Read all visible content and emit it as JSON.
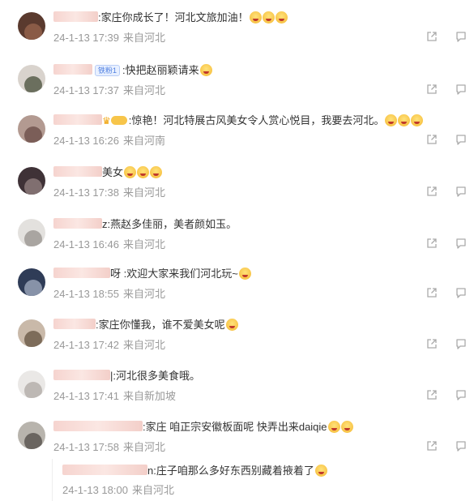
{
  "comments": [
    {
      "text": ":家庄你成长了！河北文旅加油！",
      "emojis": 3,
      "time": "24-1-13 17:39",
      "location": "来自河北",
      "avatar": [
        "#5a3a2e",
        "#8a5b46"
      ]
    },
    {
      "text": ":快把赵丽颖请来",
      "emojis": 1,
      "badge": "铁粉1",
      "time": "24-1-13 17:37",
      "location": "来自河北",
      "avatar": [
        "#d9d3cd",
        "#6b6f5e"
      ]
    },
    {
      "text": ":惊艳！河北特展古风美女令人赏心悦目，我要去河北。",
      "emojis": 3,
      "crown": true,
      "time": "24-1-13 16:26",
      "location": "来自河南",
      "avatar": [
        "#b39a91",
        "#7b5e58"
      ]
    },
    {
      "text": "美女",
      "emojis": 3,
      "time": "24-1-13 17:38",
      "location": "来自河北",
      "avatar": [
        "#3f3237",
        "#806f70"
      ]
    },
    {
      "text": "z:燕赵多佳丽，美者颜如玉。",
      "emojis": 0,
      "time": "24-1-13 16:46",
      "location": "来自河北",
      "avatar": [
        "#e3e1de",
        "#a9a5a1"
      ]
    },
    {
      "text": "呀 :欢迎大家来我们河北玩~",
      "emojis": 1,
      "time": "24-1-13 18:55",
      "location": "来自河北",
      "avatar": [
        "#2f3c57",
        "#8792a8"
      ]
    },
    {
      "text": ":家庄你懂我，谁不爱美女呢",
      "emojis": 1,
      "time": "24-1-13 17:42",
      "location": "来自河北",
      "avatar": [
        "#c9b9a9",
        "#7d6c5a"
      ]
    },
    {
      "text": "|:河北很多美食哦。",
      "emojis": 0,
      "time": "24-1-13 17:41",
      "location": "来自新加坡",
      "avatar": [
        "#eae8e6",
        "#bdb8b4"
      ]
    },
    {
      "text": ":家庄 咱正宗安徽板面呢 快弄出来daiqie",
      "emojis": 2,
      "time": "24-1-13 17:58",
      "location": "来自河北",
      "avatar": [
        "#b8b4ad",
        "#6a6560"
      ]
    }
  ],
  "subreply": {
    "text": "n:庄子咱那么多好东西别藏着掖着了",
    "emojis": 1,
    "time": "24-1-13 18:00",
    "location": "来自河北"
  },
  "icons": {
    "share": "share-icon",
    "reply": "reply-icon",
    "emoji": "emoji-icon"
  },
  "colors": {
    "meta": "#999999",
    "text": "#333333",
    "badge": "#4f7fe0"
  }
}
